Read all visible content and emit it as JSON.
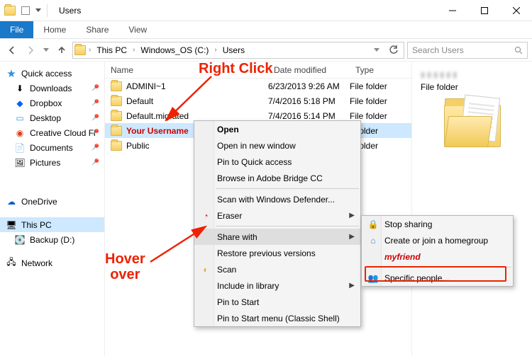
{
  "window": {
    "title": "Users"
  },
  "ribbon": {
    "file": "File",
    "home": "Home",
    "share": "Share",
    "view": "View"
  },
  "address": {
    "crumbs": [
      "This PC",
      "Windows_OS (C:)",
      "Users"
    ],
    "search_placeholder": "Search Users"
  },
  "nav": {
    "quick_access": "Quick access",
    "downloads": "Downloads",
    "dropbox": "Dropbox",
    "desktop": "Desktop",
    "creative": "Creative Cloud Fi",
    "documents": "Documents",
    "pictures": "Pictures",
    "onedrive": "OneDrive",
    "this_pc": "This PC",
    "backup": "Backup (D:)",
    "network": "Network"
  },
  "columns": {
    "name": "Name",
    "date": "Date modified",
    "type": "Type"
  },
  "files": {
    "r0": {
      "name": "ADMINI~1",
      "date": "6/23/2013 9:26 AM",
      "type": "File folder"
    },
    "r1": {
      "name": "Default",
      "date": "7/4/2016 5:18 PM",
      "type": "File folder"
    },
    "r2": {
      "name": "Default.migrated",
      "date": "7/4/2016 5:14 PM",
      "type": "File folder"
    },
    "r3": {
      "name": "Your Username",
      "date": "",
      "type": "e folder"
    },
    "r4": {
      "name": "Public",
      "date": "",
      "type": "e folder"
    }
  },
  "preview": {
    "type": "File folder"
  },
  "ctx1": {
    "open": "Open",
    "open_new": "Open in new window",
    "pin_qa": "Pin to Quick access",
    "bridge": "Browse in Adobe Bridge CC",
    "defender": "Scan with Windows Defender...",
    "eraser": "Eraser",
    "share_with": "Share with",
    "restore": "Restore previous versions",
    "scan": "Scan",
    "include": "Include in library",
    "pin_start": "Pin to Start",
    "pin_start_cs": "Pin to Start menu (Classic Shell)"
  },
  "ctx2": {
    "stop": "Stop sharing",
    "homegroup": "Create or join a homegroup",
    "myfriend": "myfriend",
    "specific": "Specific people..."
  },
  "ann": {
    "right_click": "Right Click",
    "hover": "Hover\nover"
  }
}
